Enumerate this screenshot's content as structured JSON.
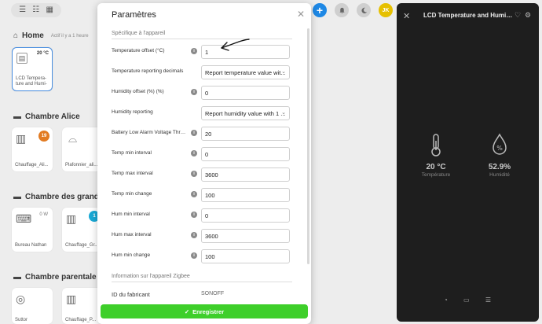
{
  "topbar": {
    "view_icons": [
      "☰",
      "☷",
      "▦"
    ],
    "avatar_initials": "JK"
  },
  "sections": {
    "home": {
      "title": "Home",
      "subtitle": "Actif il y a 1 heure"
    },
    "alice": {
      "title": "Chambre Alice"
    },
    "grands": {
      "title": "Chambre des grands"
    },
    "parentale": {
      "title": "Chambre parentale"
    }
  },
  "tiles": {
    "lcd": {
      "temp": "20 °C",
      "label": "LCD Tempera-ture and Humi-"
    },
    "chauffage_alice": {
      "badge": "19",
      "label": "Chauffage_Ali..."
    },
    "plafonnier_alice": {
      "label": "Plafonnier_ali..."
    },
    "bureau_nathan": {
      "watts": "0 W",
      "label": "Bureau Nathan"
    },
    "chauffage_gr": {
      "badge": "1",
      "label": "Chauffage_Gr..."
    },
    "parentale_1": {
      "label": "Suttor"
    },
    "parentale_2": {
      "label": "Chauffage_P..."
    }
  },
  "modal": {
    "title": "Paramètres",
    "group_device": "Spécifique à l'appareil",
    "group_zigbee": "Information sur l'appareil Zigbee",
    "rows": [
      {
        "label": "Temperature offset (°C)",
        "value": "1"
      },
      {
        "label": "Temperature reporting decimals",
        "value": "Report temperature value wit..."
      },
      {
        "label": "Humidity offset (%) (%)",
        "value": "0"
      },
      {
        "label": "Humidity reporting",
        "value": "Report humidity value with 1 ..."
      },
      {
        "label": "Battery Low Alarm Voltage Thresh...",
        "value": "20"
      },
      {
        "label": "Temp min interval",
        "value": "0"
      },
      {
        "label": "Temp max interval",
        "value": "3600"
      },
      {
        "label": "Temp min change",
        "value": "100"
      },
      {
        "label": "Hum min interval",
        "value": "0"
      },
      {
        "label": "Hum max interval",
        "value": "3600"
      },
      {
        "label": "Hum min change",
        "value": "100"
      }
    ],
    "manufacturer": {
      "label": "ID du fabricant",
      "value": "SONOFF"
    },
    "save_label": "Enregistrer"
  },
  "panel": {
    "title": "LCD Temperature and Humidity",
    "temperature": {
      "value": "20 °C",
      "label": "Température"
    },
    "humidity": {
      "value": "52.9%",
      "label": "Humidité"
    }
  },
  "colors": {
    "save": "#3ecf2a",
    "primary": "#1e88e5",
    "badge_orange": "#e27b22",
    "badge_cyan": "#19a9d6",
    "panel_bg": "#1e1e1e"
  }
}
